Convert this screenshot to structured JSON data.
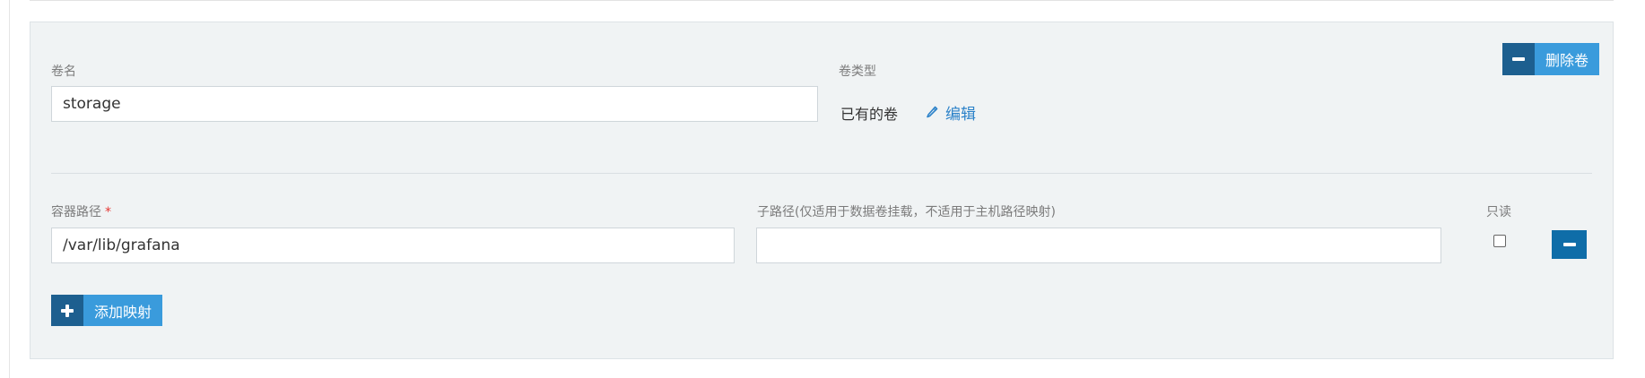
{
  "volume": {
    "name_label": "卷名",
    "name_value": "storage",
    "type_label": "卷类型",
    "type_value": "已有的卷",
    "edit_label": "编辑",
    "delete_label": "删除卷"
  },
  "mapping": {
    "container_path_label": "容器路径",
    "required_mark": "*",
    "container_path_value": "/var/lib/grafana",
    "subpath_label": "子路径(仅适用于数据卷挂载，不适用于主机路径映射)",
    "subpath_value": "",
    "readonly_label": "只读",
    "readonly_checked": false,
    "add_label": "添加映射"
  },
  "colors": {
    "accent": "#3a9bdc",
    "accent_dark": "#1d5f8f",
    "link": "#2c82c9",
    "required": "#e53935"
  }
}
